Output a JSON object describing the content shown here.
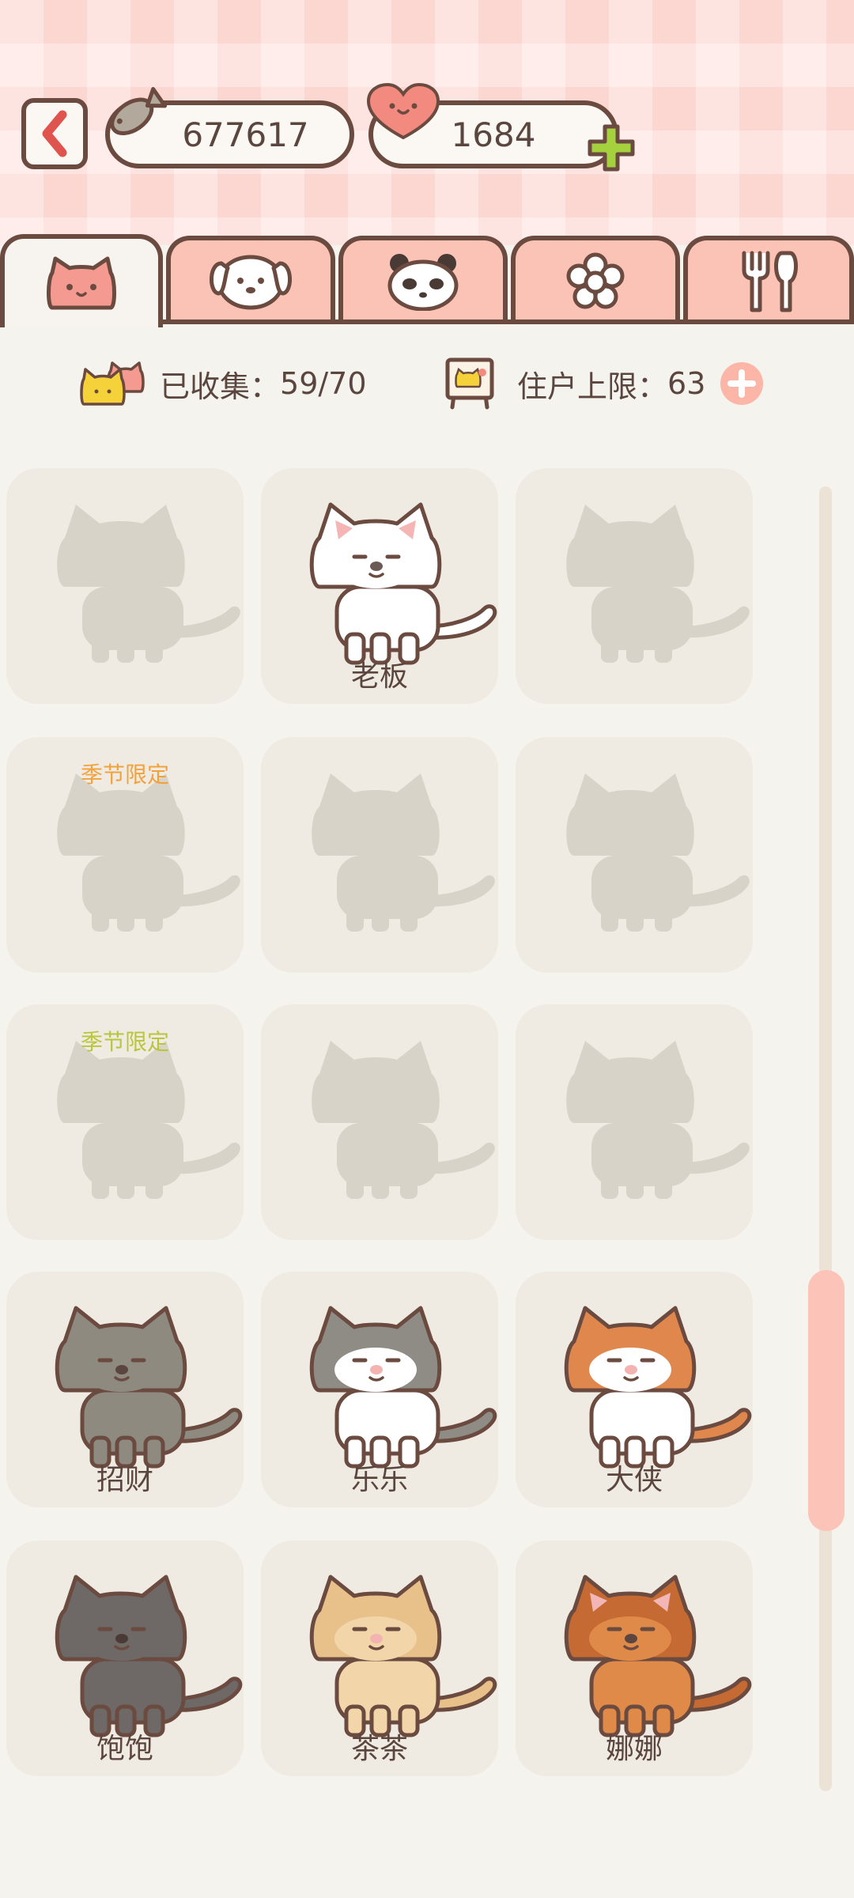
{
  "header": {
    "fish_count": "677617",
    "heart_count": "1684",
    "icons": {
      "back": "back-arrow-icon",
      "fish": "fish-icon",
      "heart": "heart-icon",
      "add": "plus-icon"
    }
  },
  "tabs": [
    {
      "name": "cat",
      "icon": "cat-face-icon",
      "active": true
    },
    {
      "name": "dog",
      "icon": "dog-face-icon",
      "active": false
    },
    {
      "name": "panda",
      "icon": "panda-face-icon",
      "active": false
    },
    {
      "name": "flower",
      "icon": "flower-icon",
      "active": false
    },
    {
      "name": "utensils",
      "icon": "fork-spoon-icon",
      "active": false
    }
  ],
  "stats": {
    "collected_label": "已收集：",
    "collected_value": "59/70",
    "limit_label": "住户上限：",
    "limit_value": "63"
  },
  "cards": [
    {
      "label": "",
      "locked": true,
      "season": "",
      "colors": null
    },
    {
      "label": "老板",
      "locked": false,
      "season": "",
      "colors": {
        "body": "#ffffff",
        "patch": "#ffffff",
        "ear": "#f5b5b5",
        "nose": "#6b5a55"
      }
    },
    {
      "label": "",
      "locked": true,
      "season": "",
      "colors": null
    },
    {
      "label": "",
      "locked": true,
      "season": "季节限定",
      "season_color": "#f2a23c",
      "colors": null
    },
    {
      "label": "",
      "locked": true,
      "season": "",
      "colors": null
    },
    {
      "label": "",
      "locked": true,
      "season": "",
      "colors": null
    },
    {
      "label": "",
      "locked": true,
      "season": "季节限定",
      "season_color": "#b8c63b",
      "colors": null
    },
    {
      "label": "",
      "locked": true,
      "season": "",
      "colors": null
    },
    {
      "label": "",
      "locked": true,
      "season": "",
      "colors": null
    },
    {
      "label": "招财",
      "locked": false,
      "season": "",
      "colors": {
        "body": "#8f8a80",
        "patch": "#8f8a80",
        "ear": "#8f8a80",
        "nose": "#5b463f"
      }
    },
    {
      "label": "乐乐",
      "locked": false,
      "season": "",
      "colors": {
        "body": "#ffffff",
        "patch": "#8f8b85",
        "ear": "#8f8b85",
        "nose": "#f3b3b0"
      }
    },
    {
      "label": "大侠",
      "locked": false,
      "season": "",
      "colors": {
        "body": "#ffffff",
        "patch": "#e0874e",
        "ear": "#e0874e",
        "nose": "#f3b3b0"
      }
    },
    {
      "label": "饱饱",
      "locked": false,
      "season": "",
      "colors": {
        "body": "#6e6866",
        "patch": "#6e6866",
        "ear": "#6e6866",
        "nose": "#4a3a35"
      }
    },
    {
      "label": "茶茶",
      "locked": false,
      "season": "",
      "colors": {
        "body": "#f2d6aa",
        "patch": "#e8c08a",
        "ear": "#e8c08a",
        "nose": "#f3b3b0"
      }
    },
    {
      "label": "娜娜",
      "locked": false,
      "season": "",
      "colors": {
        "body": "#e08a4a",
        "patch": "#c56a32",
        "ear": "#f2b6b6",
        "nose": "#5b463f"
      }
    }
  ]
}
